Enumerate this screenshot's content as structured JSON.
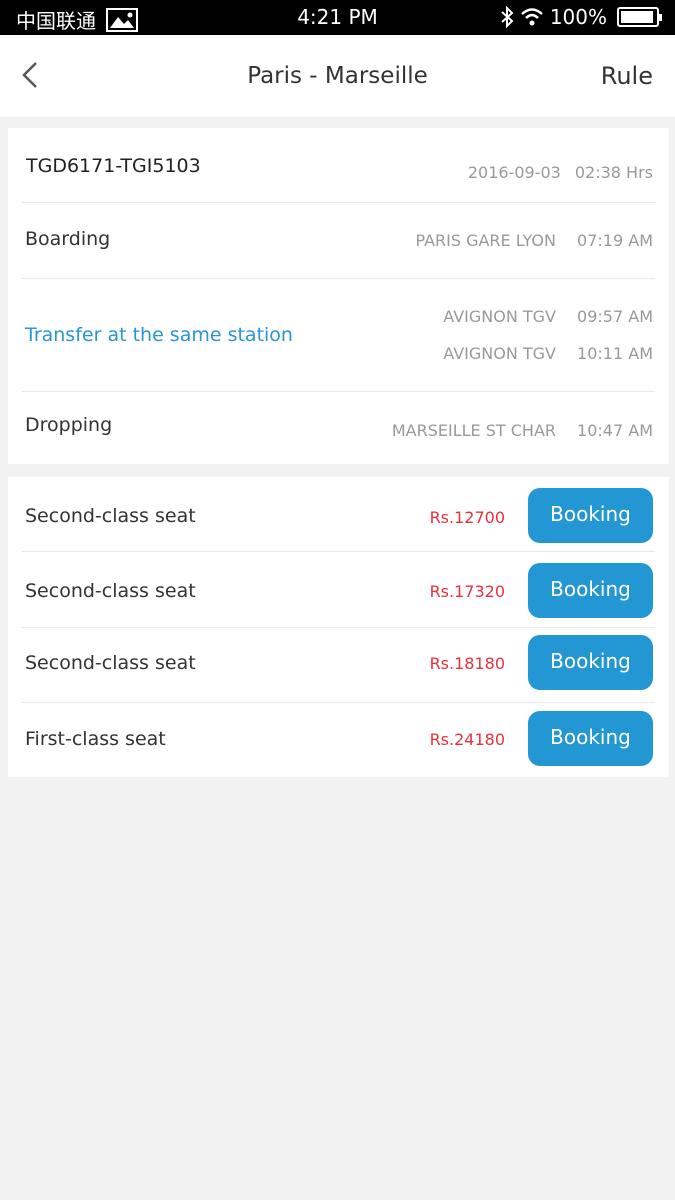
{
  "status_bar": {
    "carrier": "中国联通",
    "time": "4:21 PM",
    "battery": "100%",
    "battery_level": 1.0,
    "icons": [
      "image-icon",
      "bluetooth-icon",
      "wifi-icon",
      "battery-icon"
    ]
  },
  "nav": {
    "title": "Paris - Marseille",
    "rule_label": "Rule",
    "back_icon": "chevron-left-icon"
  },
  "train": {
    "number": "TGD6171-TGI5103",
    "date": "2016-09-03",
    "duration": "02:38 Hrs"
  },
  "stops": {
    "boarding": {
      "label": "Boarding",
      "station": "PARIS GARE LYON",
      "time": "07:19 AM"
    },
    "transfer": {
      "label": "Transfer at the same station",
      "arrive_station": "AVIGNON TGV",
      "arrive_time": "09:57 AM",
      "depart_station": "AVIGNON TGV",
      "depart_time": "10:11 AM"
    },
    "dropping": {
      "label": "Dropping",
      "station": "MARSEILLE ST CHAR",
      "time": "10:47 AM"
    }
  },
  "seats": [
    {
      "label": "Second-class seat",
      "price": "Rs.12700",
      "button": "Booking"
    },
    {
      "label": "Second-class seat",
      "price": "Rs.17320",
      "button": "Booking"
    },
    {
      "label": "Second-class seat",
      "price": "Rs.18180",
      "button": "Booking"
    },
    {
      "label": "First-class seat",
      "price": "Rs.24180",
      "button": "Booking"
    }
  ],
  "colors": {
    "accent": "#2396d4",
    "link": "#2a95d1",
    "price": "#e8303c",
    "background": "#f3f2f3"
  }
}
